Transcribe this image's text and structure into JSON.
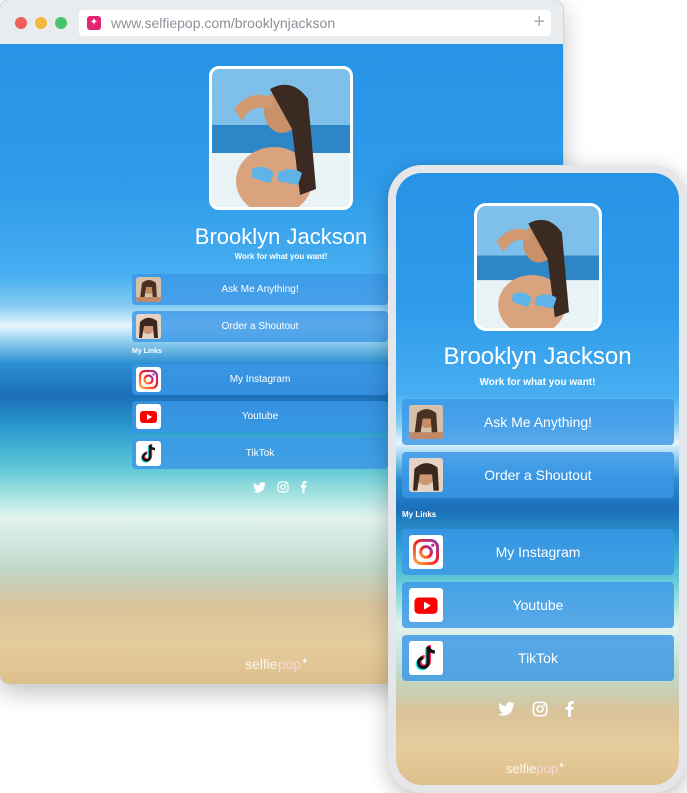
{
  "browser": {
    "url": "www.selfiepop.com/brooklynjackson",
    "favicon": "selfiepop-favicon-icon",
    "new_tab": "+"
  },
  "profile": {
    "name": "Brooklyn Jackson",
    "tagline": "Work for what you want!"
  },
  "services": [
    {
      "label": "Ask Me Anything!",
      "thumb": "profile-photo-thumb"
    },
    {
      "label": "Order a Shoutout",
      "thumb": "profile-photo-thumb"
    }
  ],
  "my_links_heading": "My Links",
  "links": [
    {
      "label": "My Instagram",
      "icon": "instagram-icon"
    },
    {
      "label": "Youtube",
      "icon": "youtube-icon"
    },
    {
      "label": "TikTok",
      "icon": "tiktok-icon"
    }
  ],
  "social": [
    "twitter-icon",
    "instagram-icon",
    "facebook-icon"
  ],
  "brand": {
    "part1": "selfie",
    "part2": "pop"
  },
  "colors": {
    "brand_pink": "#e4256f",
    "sky": "#2793e6",
    "button": "#3a97e6"
  }
}
